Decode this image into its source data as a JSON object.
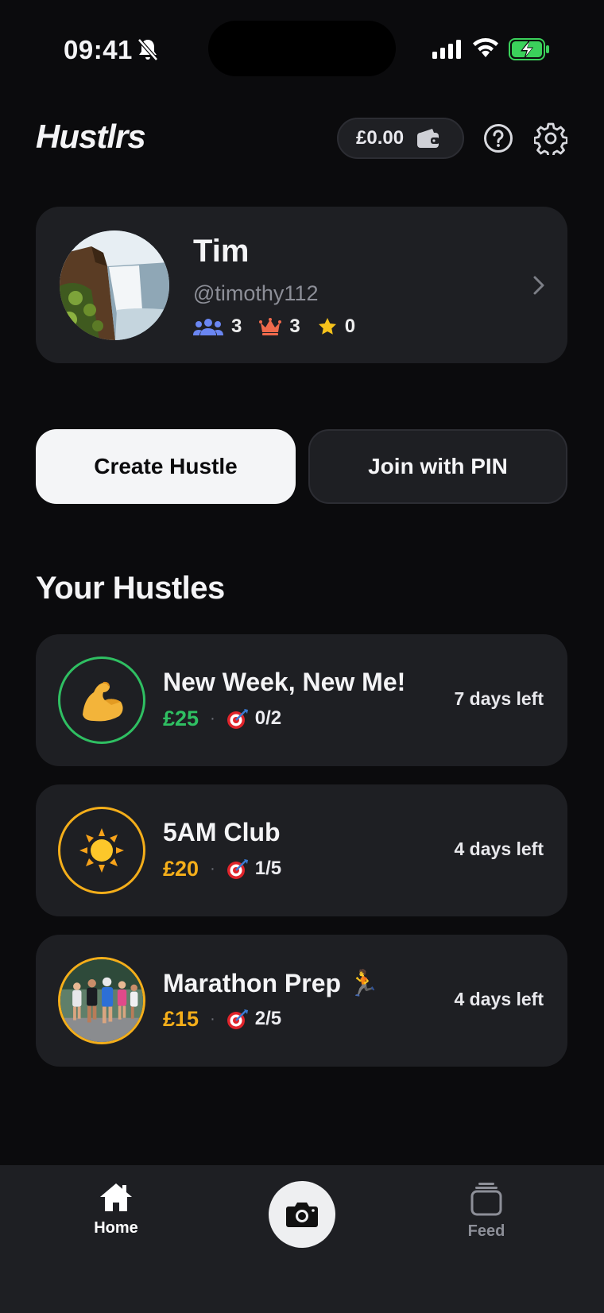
{
  "status_bar": {
    "time": "09:41"
  },
  "header": {
    "logo": "Hustlrs",
    "wallet_amount": "£0.00"
  },
  "profile": {
    "name": "Tim",
    "handle": "@timothy112",
    "stats": {
      "groups": "3",
      "crowns": "3",
      "stars": "0"
    }
  },
  "actions": {
    "create_label": "Create Hustle",
    "join_label": "Join with PIN"
  },
  "section_title": "Your Hustles",
  "hustles": [
    {
      "title": "New Week, New Me!",
      "amount": "£25",
      "goal": "0/2",
      "days_left": "7 days left",
      "icon": "flexed-biceps-icon",
      "accent": "#2fbf62"
    },
    {
      "title": "5AM Club",
      "amount": "£20",
      "goal": "1/5",
      "days_left": "4 days left",
      "icon": "sun-icon",
      "accent": "#f4ae1a"
    },
    {
      "title": "Marathon Prep 🏃",
      "amount": "£15",
      "goal": "2/5",
      "days_left": "4 days left",
      "icon": "runners-photo",
      "accent": "#f4ae1a"
    }
  ],
  "tabbar": {
    "home_label": "Home",
    "feed_label": "Feed"
  },
  "colors": {
    "background": "#0b0b0d",
    "card": "#1e1f23",
    "green": "#2fbf62",
    "amber": "#f4ae1a",
    "blue": "#6a86f2",
    "coral": "#f06a4c",
    "star": "#f5c21b"
  }
}
